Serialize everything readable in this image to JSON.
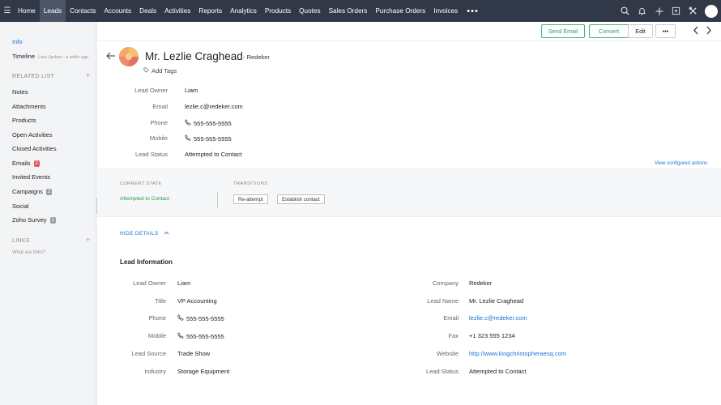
{
  "nav": {
    "tabs": [
      "Home",
      "Leads",
      "Contacts",
      "Accounts",
      "Deals",
      "Activities",
      "Reports",
      "Analytics",
      "Products",
      "Quotes",
      "Sales Orders",
      "Purchase Orders",
      "Invoices"
    ],
    "active": "Leads",
    "more": "•••"
  },
  "sidebar": {
    "info": "Info",
    "timeline": "Timeline",
    "timeline_sub": "Last Update : a while ago",
    "related_head": "RELATED LIST",
    "items": [
      {
        "label": "Notes"
      },
      {
        "label": "Attachments"
      },
      {
        "label": "Products"
      },
      {
        "label": "Open Activities"
      },
      {
        "label": "Closed Activities"
      },
      {
        "label": "Emails",
        "badge": "2",
        "badge_color": "red"
      },
      {
        "label": "Invited Events"
      },
      {
        "label": "Campaigns",
        "badge": "2",
        "badge_color": "grey"
      },
      {
        "label": "Social"
      },
      {
        "label": "Zoho Survey",
        "badge": "1",
        "badge_color": "grey"
      }
    ],
    "links_head": "LINKS",
    "links_sub": "What are links?"
  },
  "toolbar": {
    "send_email": "Send Email",
    "convert": "Convert",
    "edit": "Edit",
    "more": "•••"
  },
  "record": {
    "name": "Mr. Lezlie Craghead",
    "company": "- Redeker",
    "add_tags": "Add Tags"
  },
  "summary": [
    {
      "label": "Lead Owner",
      "value": "Liam"
    },
    {
      "label": "Email",
      "value": "lezlie.c@redeker.com"
    },
    {
      "label": "Phone",
      "value": "555-555-5555",
      "phone": true
    },
    {
      "label": "Mobile",
      "value": "555-555-5555",
      "phone": true
    },
    {
      "label": "Lead Status",
      "value": "Attempted to Contact"
    }
  ],
  "view_configured": "View configured actions",
  "blueprint": {
    "current_head": "CURRENT STATE",
    "current": "Attempted to Contact",
    "transitions_head": "TRANSITIONS",
    "transitions": [
      "Re-attempt",
      "Establish contact"
    ]
  },
  "hide_details": "HIDE DETAILS",
  "lead_info": {
    "title": "Lead Information",
    "left": [
      {
        "label": "Lead Owner",
        "value": "Liam"
      },
      {
        "label": "Title",
        "value": "VP Accounting"
      },
      {
        "label": "Phone",
        "value": "555-555-5555",
        "phone": true
      },
      {
        "label": "Mobile",
        "value": "555-555-5555",
        "phone": true
      },
      {
        "label": "Lead Source",
        "value": "Trade Show"
      },
      {
        "label": "Industry",
        "value": "Storage Equipment"
      }
    ],
    "right": [
      {
        "label": "Company",
        "value": "Redeker"
      },
      {
        "label": "Lead Name",
        "value": "Mr. Lezlie Craghead"
      },
      {
        "label": "Email",
        "value": "lezlie.c@redeker.com",
        "link": true
      },
      {
        "label": "Fax",
        "value": "+1 323 555 1234"
      },
      {
        "label": "Website",
        "value": "http://www.kingchristopheraesq.com",
        "link": true
      },
      {
        "label": "Lead Status",
        "value": "Attempted to Contact"
      }
    ]
  },
  "colors": {
    "topbar": "#313949",
    "accent": "#1a73d9",
    "green": "#2f9a6a",
    "state_green": "#2a9a45"
  }
}
